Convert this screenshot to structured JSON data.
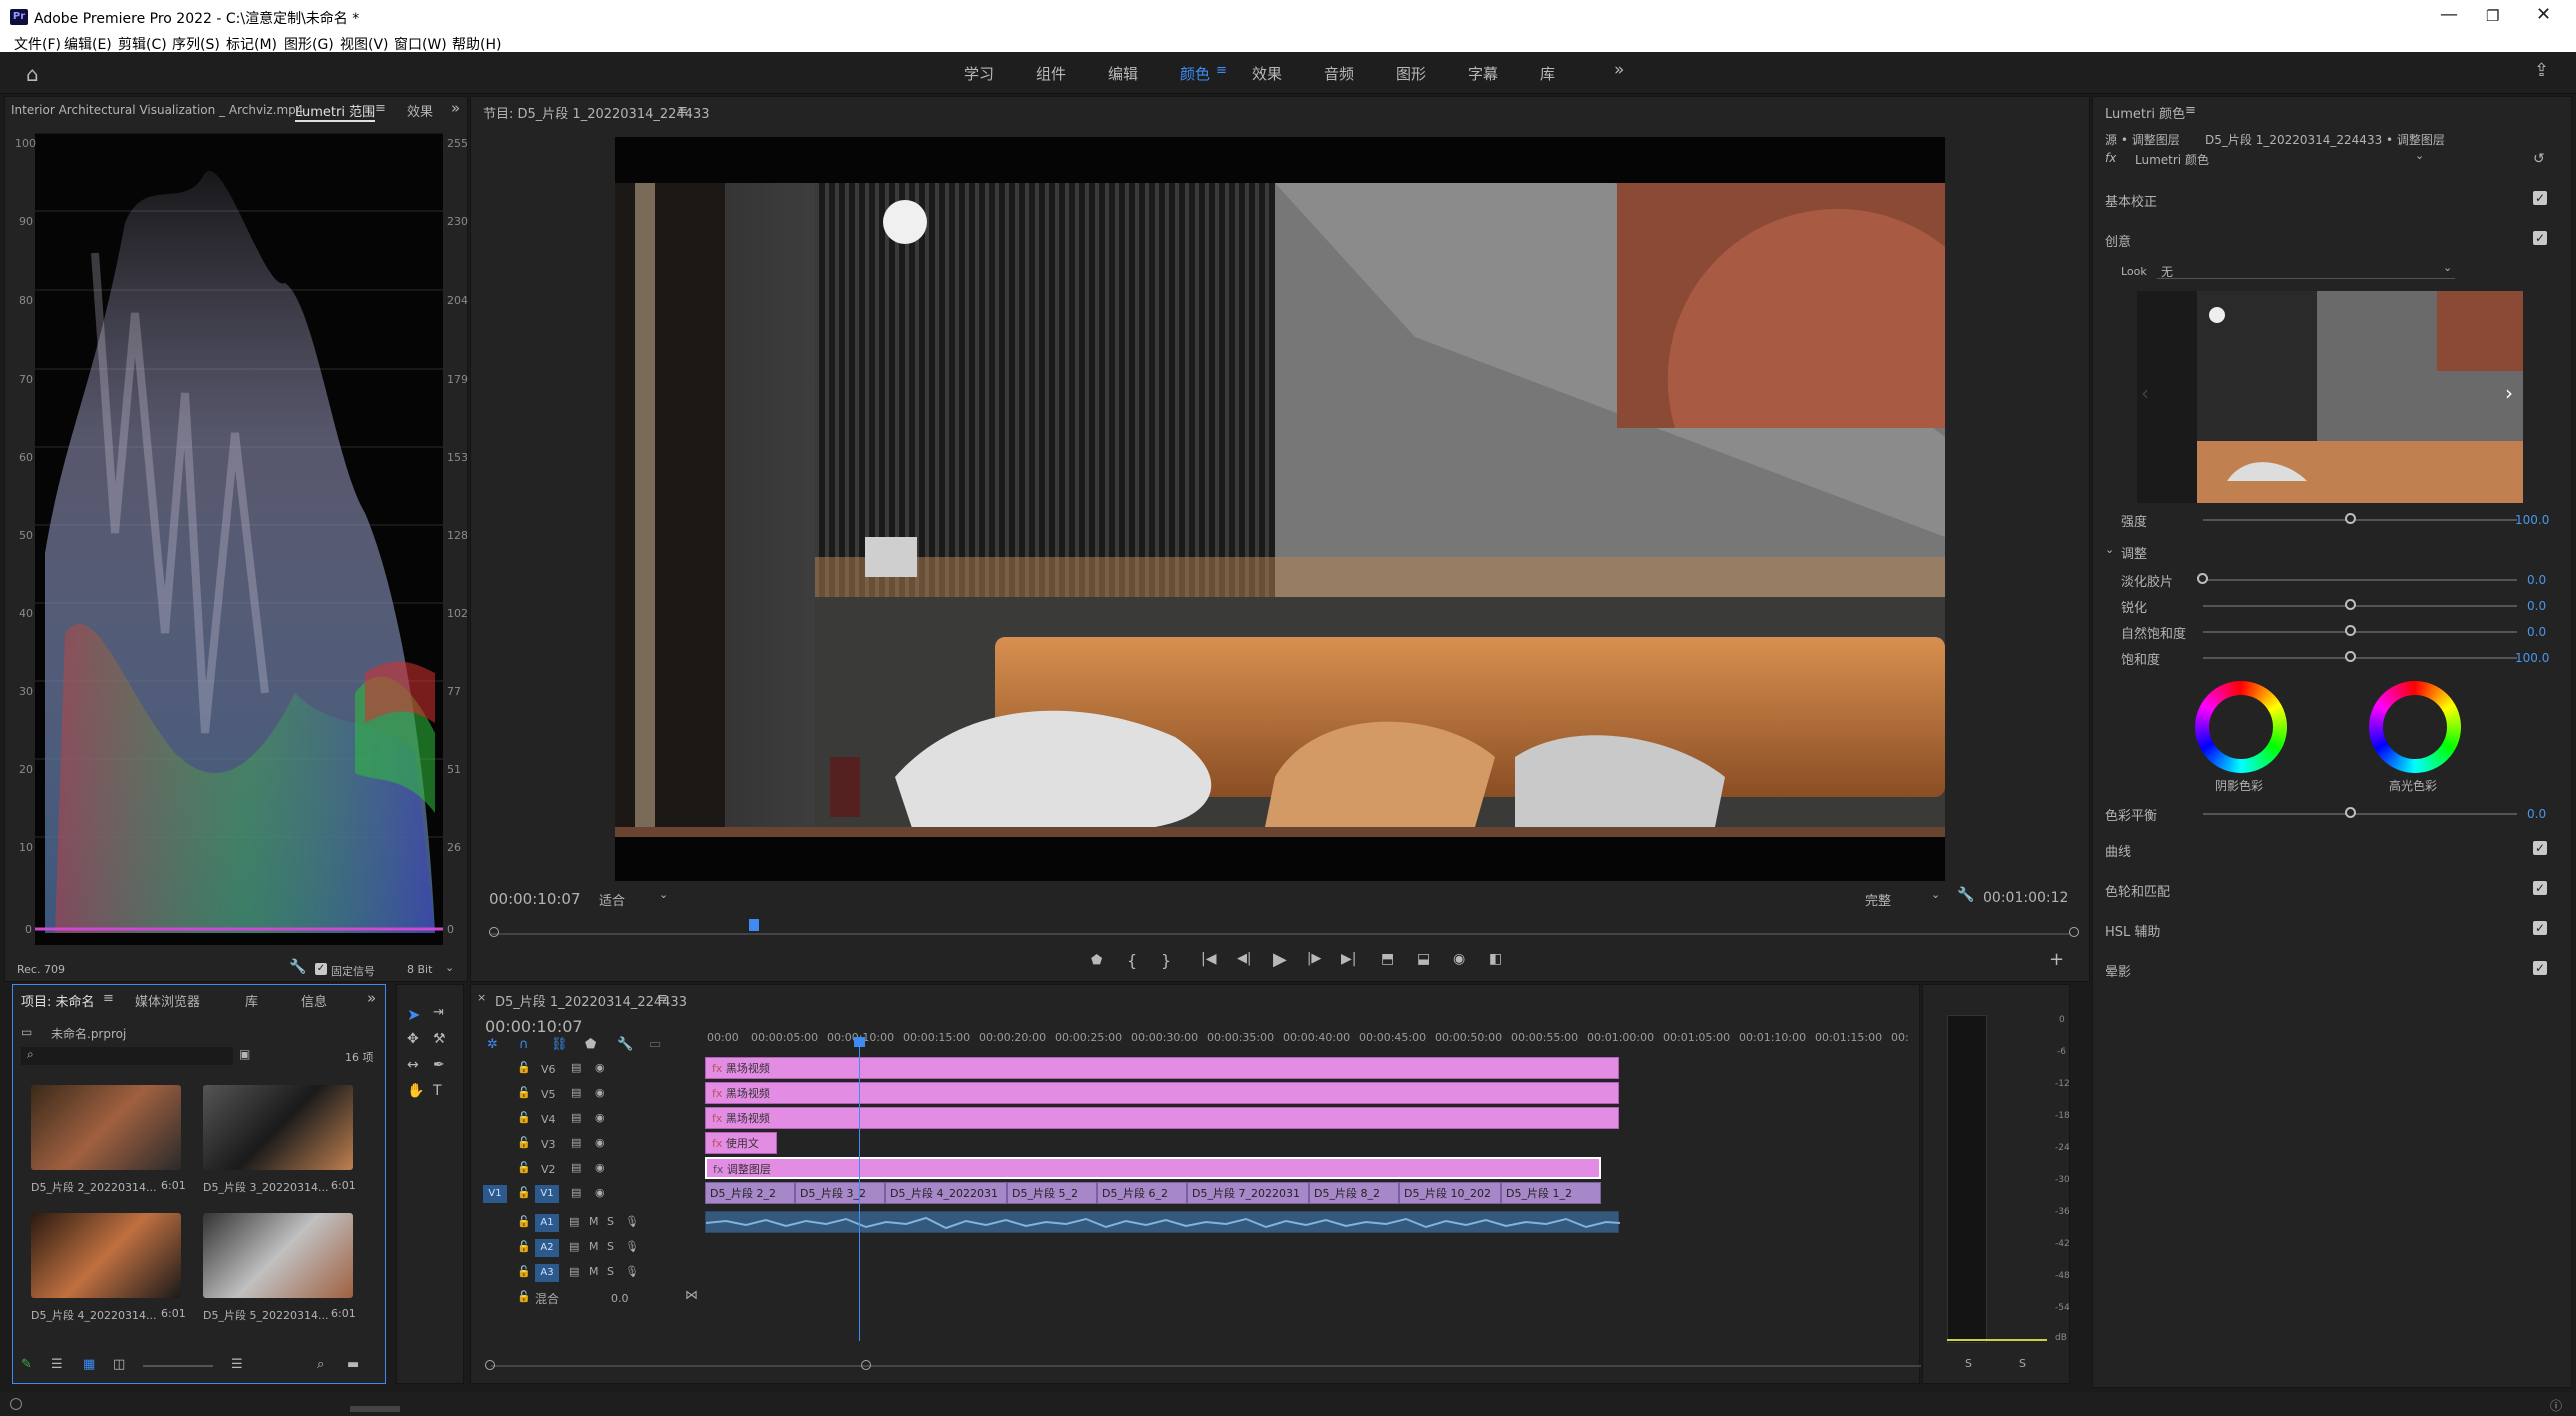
{
  "app": {
    "title": "Adobe Premiere Pro 2022 - C:\\渲意定制\\未命名 *",
    "icon": "Pr"
  },
  "menu": [
    "文件(F)",
    "编辑(E)",
    "剪辑(C)",
    "序列(S)",
    "标记(M)",
    "图形(G)",
    "视图(V)",
    "窗口(W)",
    "帮助(H)"
  ],
  "workspaces": [
    "学习",
    "组件",
    "编辑",
    "颜色",
    "效果",
    "音频",
    "图形",
    "字幕",
    "库"
  ],
  "active_workspace": "颜色",
  "source_panel": {
    "clip_tab": "Interior Architectural Visualization _ Archviz.mp4",
    "scope_tab": "Lumetri 范围",
    "effects_tab": "效果",
    "left_scale": [
      "100",
      "90",
      "80",
      "70",
      "60",
      "50",
      "40",
      "30",
      "20",
      "10",
      "0"
    ],
    "right_scale": [
      "255",
      "230",
      "204",
      "179",
      "153",
      "128",
      "102",
      "77",
      "51",
      "26",
      "0"
    ],
    "colorspace": "Rec. 709",
    "clamp_label": "固定信号",
    "bit_depth": "8 Bit"
  },
  "program": {
    "title": "节目: D5_片段 1_20220314_224433",
    "timecode": "00:00:10:07",
    "fit": "适合",
    "quality": "完整",
    "duration": "00:01:00:12"
  },
  "project": {
    "tabs": [
      "项目: 未命名",
      "媒体浏览器",
      "库",
      "信息"
    ],
    "file": "未命名.prproj",
    "count": "16 项",
    "items": [
      {
        "name": "D5_片段 2_20220314...",
        "dur": "6:01"
      },
      {
        "name": "D5_片段 3_20220314...",
        "dur": "6:01"
      },
      {
        "name": "D5_片段 4_20220314...",
        "dur": "6:01"
      },
      {
        "name": "D5_片段 5_20220314...",
        "dur": "6:01"
      }
    ]
  },
  "timeline": {
    "tab": "D5_片段 1_20220314_224433",
    "timecode": "00:00:10:07",
    "ruler": [
      "00:00",
      "00:00:05:00",
      "00:00:10:00",
      "00:00:15:00",
      "00:00:20:00",
      "00:00:25:00",
      "00:00:30:00",
      "00:00:35:00",
      "00:00:40:00",
      "00:00:45:00",
      "00:00:50:00",
      "00:00:55:00",
      "00:01:00:00",
      "00:01:05:00",
      "00:01:10:00",
      "00:01:15:00",
      "00:"
    ],
    "video_tracks": [
      "V6",
      "V5",
      "V4",
      "V3",
      "V2",
      "V1"
    ],
    "audio_tracks": [
      "A1",
      "A2",
      "A3"
    ],
    "mix_label": "混合",
    "mix_value": "0.0",
    "src_patch": "V1",
    "clips": {
      "v6": "黑场视频",
      "v5": "黑场视频",
      "v4": "黑场视频",
      "v3": "使用文",
      "v2": "调整图层",
      "v1": [
        "D5_片段 2_2",
        "D5_片段 3_2",
        "D5_片段 4_2022031",
        "D5_片段 5_2",
        "D5_片段 6_2",
        "D5_片段 7_2022031",
        "D5_片段 8_2",
        "D5_片段 10_202",
        "D5_片段 1_2"
      ]
    }
  },
  "meter": {
    "scale": [
      "0",
      "-6",
      "-12",
      "-18",
      "-24",
      "-30",
      "-36",
      "-42",
      "-48",
      "-54",
      "dB"
    ],
    "solo": [
      "S",
      "S"
    ]
  },
  "lumetri": {
    "title": "Lumetri 颜色",
    "source": "源 • 调整图层",
    "target": "D5_片段 1_20220314_224433 • 调整图层",
    "fx_name": "Lumetri 颜色",
    "sections": {
      "basic": "基本校正",
      "creative": "创意",
      "curves": "曲线",
      "wheels": "色轮和匹配",
      "hsl": "HSL 辅助",
      "vignette": "晕影"
    },
    "look_label": "Look",
    "look_value": "无",
    "intensity_label": "强度",
    "intensity": "100.0",
    "adjust_label": "调整",
    "faded": {
      "label": "淡化胶片",
      "value": "0.0"
    },
    "sharpen": {
      "label": "锐化",
      "value": "0.0"
    },
    "vibrance": {
      "label": "自然饱和度",
      "value": "0.0"
    },
    "saturation": {
      "label": "饱和度",
      "value": "100.0"
    },
    "shadow_tint": "阴影色彩",
    "highlight_tint": "高光色彩",
    "tint_balance": {
      "label": "色彩平衡",
      "value": "0.0"
    }
  },
  "colors": {
    "accent": "#4a96ea",
    "clip_pink": "#e38ce4",
    "clip_purple": "#a688c9",
    "audio_clip": "#35597d"
  }
}
